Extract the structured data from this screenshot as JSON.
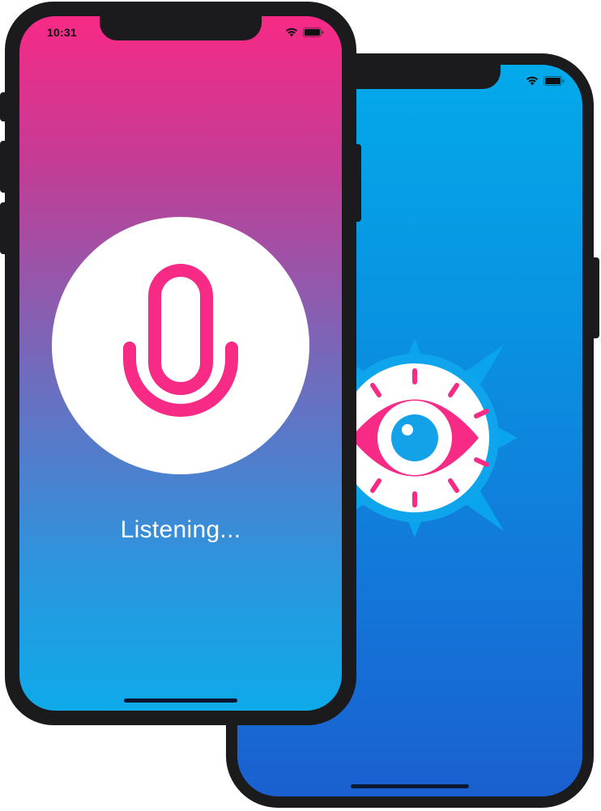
{
  "colors": {
    "accent_pink": "#f72a86",
    "back_screen_top": "#03aaea",
    "back_screen_bottom": "#1a60d0",
    "phone_frame": "#1b1b1d"
  },
  "front_phone": {
    "status_bar": {
      "time": "10:31",
      "icons": [
        "wifi-icon",
        "battery-icon"
      ]
    },
    "microphone_icon": "microphone-icon",
    "status_text": "Listening..."
  },
  "back_phone": {
    "status_bar": {
      "icons": [
        "wifi-icon",
        "battery-icon"
      ]
    },
    "logo_icon": "eye-logo-icon"
  }
}
